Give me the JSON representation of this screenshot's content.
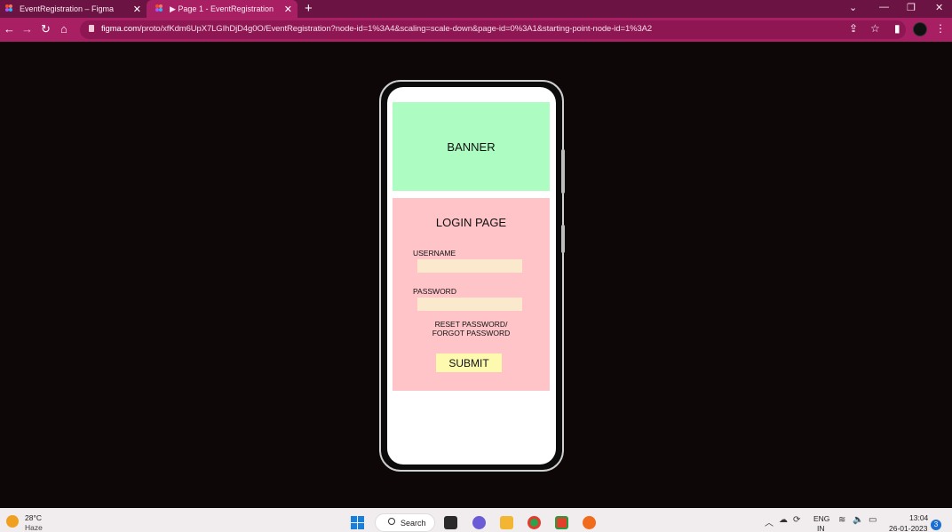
{
  "browser": {
    "tabs": [
      {
        "title": "EventRegistration – Figma",
        "active": false
      },
      {
        "title": "▶ Page 1 - EventRegistration",
        "active": true
      }
    ],
    "url_host": "figma.com",
    "url_path": "/proto/xfKdm6UpX7LGIhDjD4g0O/EventRegistration?node-id=1%3A4&scaling=scale-down&page-id=0%3A1&starting-point-node-id=1%3A2",
    "icons": [
      "figma-icon",
      "close-icon",
      "plus-icon",
      "back-icon",
      "forward-icon",
      "reload-icon",
      "home-icon",
      "lock-icon",
      "share-icon",
      "star-icon",
      "sidebar-icon",
      "avatar",
      "menu-icon"
    ],
    "accent": "#a81f64",
    "tabstrip_color": "#6b1342"
  },
  "prototype": {
    "banner_label": "BANNER",
    "login_title": "LOGIN PAGE",
    "username_label": "USERNAME",
    "username_value": "",
    "password_label": "PASSWORD",
    "password_value": "",
    "reset_line1": "RESET PASSWORD/",
    "reset_line2": "FORGOT PASSWORD",
    "submit_label": "SUBMIT",
    "colors": {
      "banner": "#adfcc2",
      "card": "#fec4c8",
      "field": "#fbe9cd",
      "submit": "#fdf9ae"
    }
  },
  "taskbar": {
    "weather_temp": "28°C",
    "weather_desc": "Haze",
    "search_label": "Search",
    "lang_line1": "ENG",
    "lang_line2": "IN",
    "time": "13:04",
    "date": "26-01-2023",
    "notification_count": "3"
  }
}
